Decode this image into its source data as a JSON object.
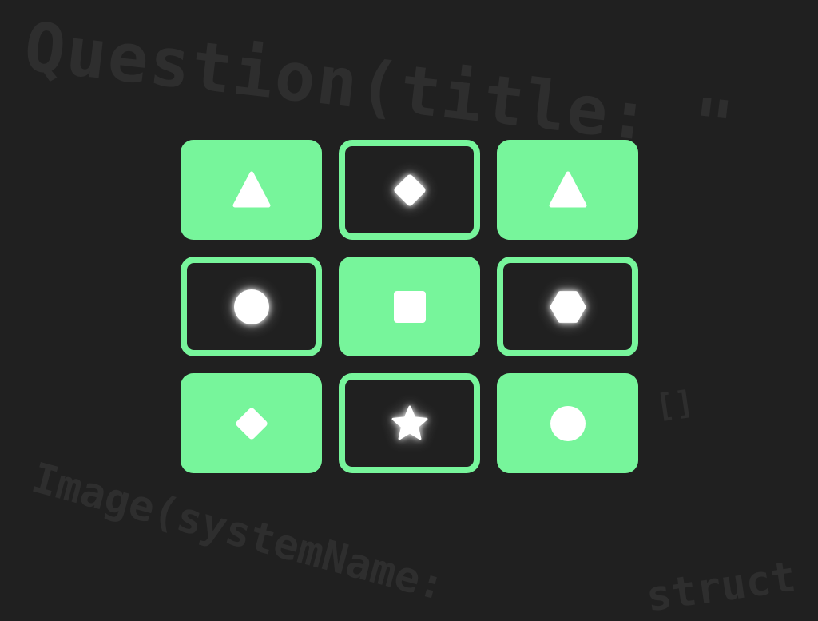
{
  "background": {
    "color": "#202020",
    "code_top": "Question(title: \"",
    "code_bottom": "Image(systemName: ",
    "code_struct": "struct",
    "code_brackets": "[]"
  },
  "colors": {
    "tile_green": "#77f59b",
    "shape_white": "#ffffff"
  },
  "grid": {
    "tiles": [
      {
        "style": "filled",
        "shape": "triangle"
      },
      {
        "style": "outline",
        "shape": "diamond"
      },
      {
        "style": "filled",
        "shape": "triangle"
      },
      {
        "style": "outline",
        "shape": "circle"
      },
      {
        "style": "filled",
        "shape": "square"
      },
      {
        "style": "outline",
        "shape": "hexagon"
      },
      {
        "style": "filled",
        "shape": "diamond"
      },
      {
        "style": "outline",
        "shape": "star"
      },
      {
        "style": "filled",
        "shape": "circle"
      }
    ]
  }
}
